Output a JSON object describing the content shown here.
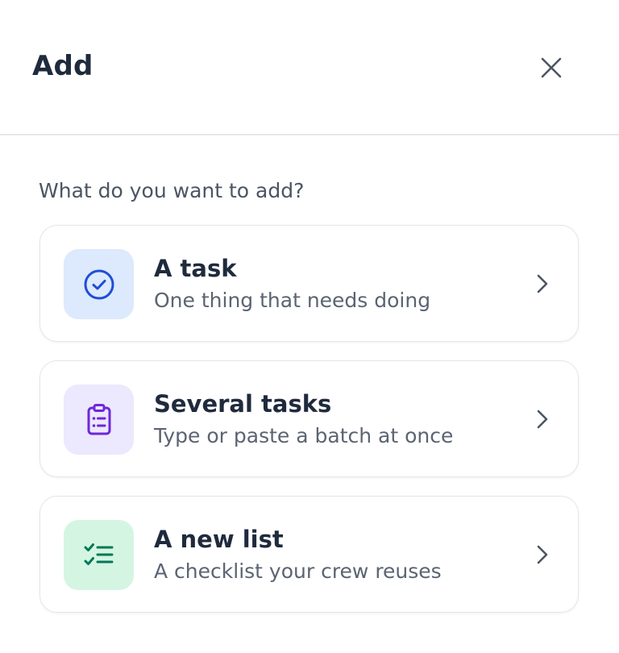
{
  "dialog": {
    "title": "Add",
    "close_icon": "close-icon",
    "prompt": "What do you want to add?"
  },
  "options": [
    {
      "label": "A task",
      "description": "One thing that needs doing",
      "icon": "circle-check-icon",
      "tile_color": "#dde9fc",
      "icon_color": "#1d4ed8"
    },
    {
      "label": "Several tasks",
      "description": "Type or paste a batch at once",
      "icon": "clipboard-list-icon",
      "tile_color": "#ece8fd",
      "icon_color": "#6d28d9"
    },
    {
      "label": "A new list",
      "description": "A checklist your crew reuses",
      "icon": "checklist-icon",
      "tile_color": "#d5f5e3",
      "icon_color": "#047857"
    }
  ],
  "chevron_icon": "chevron-right-icon"
}
